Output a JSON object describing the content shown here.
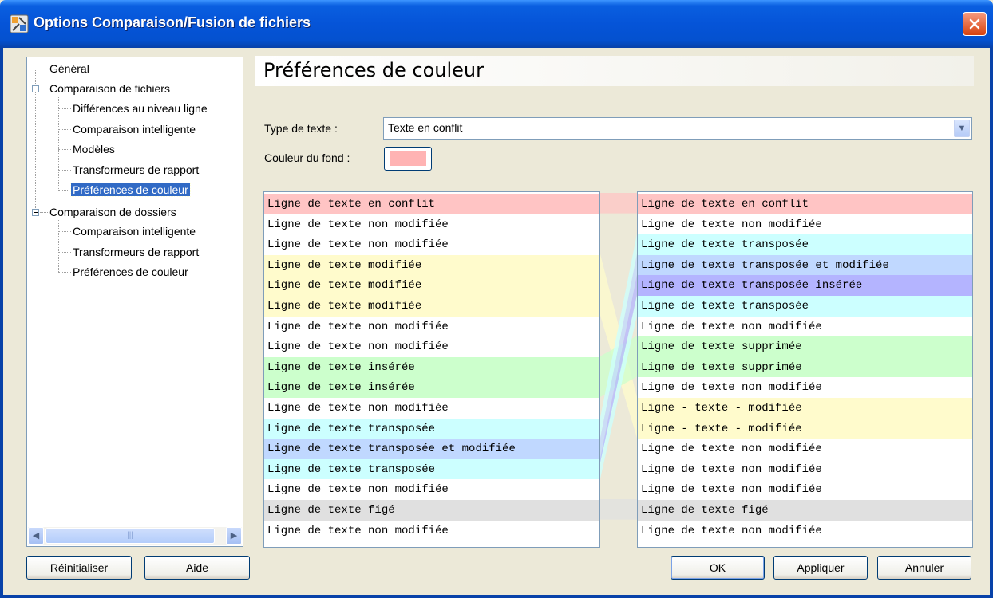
{
  "window": {
    "title": "Options Comparaison/Fusion de fichiers",
    "app_icon": "app-options-icon",
    "close_icon": "close-icon"
  },
  "tree": {
    "items": [
      {
        "label": "Général",
        "level": 0
      },
      {
        "label": "Comparaison de fichiers",
        "level": 0,
        "expanded": true
      },
      {
        "label": "Différences au niveau ligne",
        "level": 1
      },
      {
        "label": "Comparaison intelligente",
        "level": 1
      },
      {
        "label": "Modèles",
        "level": 1
      },
      {
        "label": "Transformeurs de rapport",
        "level": 1
      },
      {
        "label": "Préférences de couleur",
        "level": 1,
        "selected": true
      },
      {
        "label": "Comparaison de dossiers",
        "level": 0,
        "expanded": true
      },
      {
        "label": "Comparaison intelligente",
        "level": 1
      },
      {
        "label": "Transformeurs de rapport",
        "level": 1
      },
      {
        "label": "Préférences de couleur",
        "level": 1
      }
    ]
  },
  "main": {
    "title": "Préférences de couleur",
    "type_label": "Type de texte :",
    "type_value": "Texte en conflit",
    "bg_label": "Couleur du fond :",
    "bg_color": "#ffb3b3"
  },
  "preview": {
    "colors": {
      "conflict": "#ffc4c4",
      "unchanged": "#ffffff",
      "modified": "#fffbcc",
      "inserted": "#ccffcc",
      "transposed": "#ccffff",
      "transposed_modified": "#c0d8ff",
      "transposed_inserted": "#b4b4ff",
      "frozen": "#e0e0e0"
    },
    "left": [
      {
        "text": "Ligne de texte en conflit",
        "kind": "conflict"
      },
      {
        "text": "Ligne de texte non modifiée",
        "kind": "unchanged"
      },
      {
        "text": "Ligne de texte non modifiée",
        "kind": "unchanged"
      },
      {
        "text": "Ligne de texte modifiée",
        "kind": "modified"
      },
      {
        "text": "Ligne de texte modifiée",
        "kind": "modified"
      },
      {
        "text": "Ligne de texte modifiée",
        "kind": "modified"
      },
      {
        "text": "Ligne de texte non modifiée",
        "kind": "unchanged"
      },
      {
        "text": "Ligne de texte non modifiée",
        "kind": "unchanged"
      },
      {
        "text": "Ligne de texte insérée",
        "kind": "inserted"
      },
      {
        "text": "Ligne de texte insérée",
        "kind": "inserted"
      },
      {
        "text": "Ligne de texte non modifiée",
        "kind": "unchanged"
      },
      {
        "text": "Ligne de texte transposée",
        "kind": "transposed"
      },
      {
        "text": "Ligne de texte transposée et modifiée",
        "kind": "transposed_modified"
      },
      {
        "text": "Ligne de texte transposée",
        "kind": "transposed"
      },
      {
        "text": "Ligne de texte non modifiée",
        "kind": "unchanged"
      },
      {
        "text": "Ligne de texte figé",
        "kind": "frozen"
      },
      {
        "text": "Ligne de texte non modifiée",
        "kind": "unchanged"
      }
    ],
    "right": [
      {
        "text": "Ligne de texte en conflit",
        "kind": "conflict"
      },
      {
        "text": "Ligne de texte non modifiée",
        "kind": "unchanged"
      },
      {
        "text": "Ligne de texte transposée",
        "kind": "transposed"
      },
      {
        "text": "Ligne de texte transposée et modifiée",
        "kind": "transposed_modified"
      },
      {
        "text": "Ligne de texte transposée insérée",
        "kind": "transposed_inserted"
      },
      {
        "text": "Ligne de texte transposée",
        "kind": "transposed"
      },
      {
        "text": "Ligne de texte non modifiée",
        "kind": "unchanged"
      },
      {
        "text": "Ligne de texte supprimée",
        "kind": "inserted"
      },
      {
        "text": "Ligne de texte supprimée",
        "kind": "inserted"
      },
      {
        "text": "Ligne de texte non modifiée",
        "kind": "unchanged"
      },
      {
        "text": "Ligne - texte - modifiée",
        "kind": "modified"
      },
      {
        "text": "Ligne - texte - modifiée",
        "kind": "modified"
      },
      {
        "text": "Ligne de texte non modifiée",
        "kind": "unchanged"
      },
      {
        "text": "Ligne de texte non modifiée",
        "kind": "unchanged"
      },
      {
        "text": "Ligne de texte non modifiée",
        "kind": "unchanged"
      },
      {
        "text": "Ligne de texte figé",
        "kind": "frozen"
      },
      {
        "text": "Ligne de texte non modifiée",
        "kind": "unchanged"
      }
    ]
  },
  "buttons": {
    "reset": "Réinitialiser",
    "help": "Aide",
    "ok": "OK",
    "apply": "Appliquer",
    "cancel": "Annuler"
  }
}
